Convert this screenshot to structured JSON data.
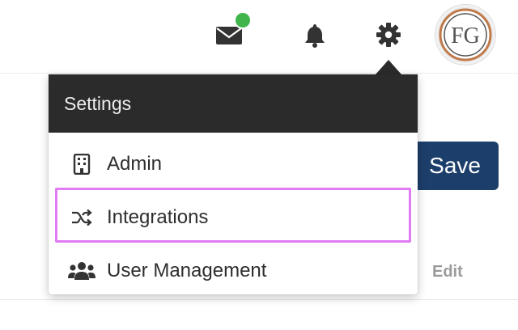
{
  "header": {
    "icons": {
      "mail": "mail-icon",
      "notifications": "bell-icon",
      "settings": "gear-icon"
    },
    "mail_status_color": "#3fb54b",
    "avatar": {
      "initials": "FG"
    }
  },
  "page": {
    "save_label": "Save",
    "edit_label": "Edit"
  },
  "settings_menu": {
    "title": "Settings",
    "items": [
      {
        "label": "Admin",
        "icon": "building-icon"
      },
      {
        "label": "Integrations",
        "icon": "shuffle-icon",
        "highlighted": true
      },
      {
        "label": "User Management",
        "icon": "users-icon"
      }
    ],
    "highlight_color": "#e07bf3"
  },
  "colors": {
    "menu_header_bg": "#2b2b2c",
    "save_button_bg": "#1c3e6a"
  }
}
